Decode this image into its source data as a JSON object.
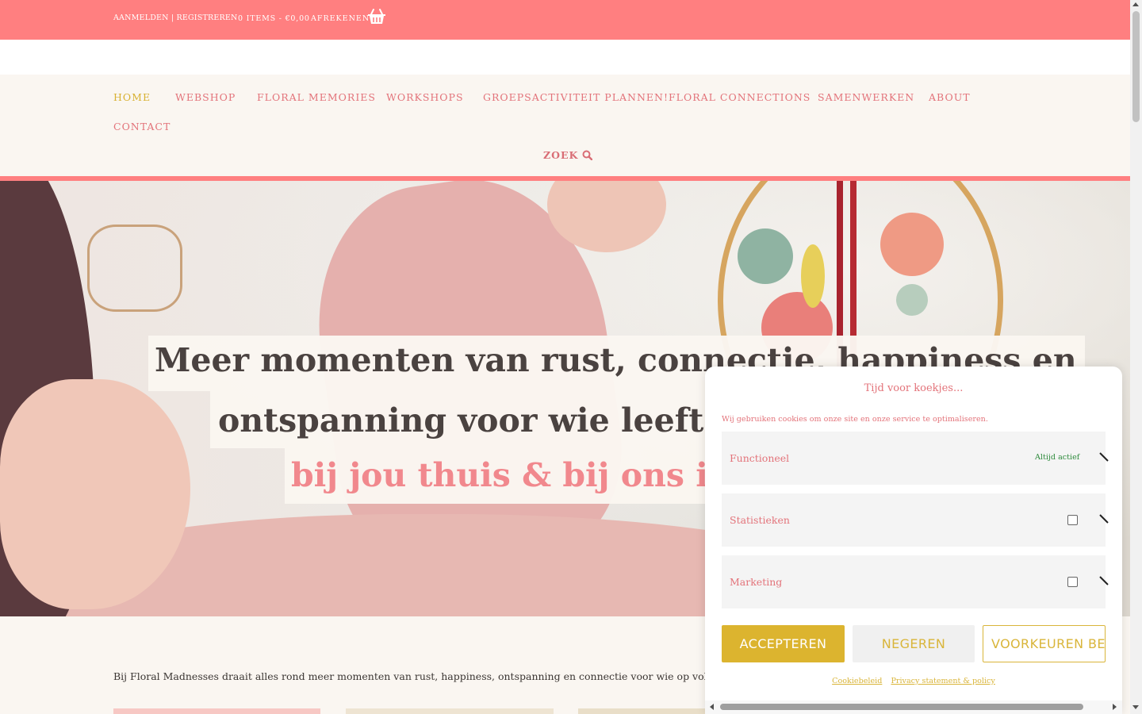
{
  "topbar": {
    "auth": "AANMELDEN | REGISTREREN",
    "cart": "0 ITEMS - €0,00",
    "checkout": "AFREKENEN",
    "basket_icon": "basket-icon"
  },
  "nav": {
    "items": [
      {
        "label": "HOME",
        "active": true
      },
      {
        "label": "WEBSHOP"
      },
      {
        "label": "FLORAL MEMORIES"
      },
      {
        "label": "WORKSHOPS"
      },
      {
        "label": "GROEPSACTIVITEIT PLANNEN!"
      },
      {
        "label": "FLORAL CONNECTIONS"
      },
      {
        "label": "SAMENWERKEN"
      },
      {
        "label": "ABOUT"
      },
      {
        "label": "CONTACT"
      }
    ],
    "search_label": "ZOEK",
    "search_icon": "search-icon"
  },
  "hero": {
    "line1": "Meer momenten van rust, connectie, happiness en",
    "line2": "ontspanning voor wie leeft op volle toeren",
    "line3": "bij jou thuis & bij ons in Meerhout"
  },
  "intro": "Bij Floral Madnesses draait alles rond meer momenten van rust, happiness, ontspanning en connectie voor wie op volle toeren leeft en",
  "cookie": {
    "title": "Tijd voor koekjes...",
    "message": "Wij gebruiken cookies om onze site en onze service te optimaliseren.",
    "categories": [
      {
        "name": "Functioneel",
        "status": "Altijd actief"
      },
      {
        "name": "Statistieken"
      },
      {
        "name": "Marketing"
      }
    ],
    "buttons": {
      "accept": "ACCEPTEREN",
      "deny": "NEGEREN",
      "prefs": "VOORKEUREN BEWAREN"
    },
    "links": {
      "cookie_policy": "Cookiebeleid",
      "privacy": "Privacy statement & policy"
    }
  },
  "colors": {
    "brand_pink": "#ff7f80",
    "nav_text": "#e3737a",
    "accent_gold": "#dcb42f",
    "background": "#faf6f1"
  }
}
